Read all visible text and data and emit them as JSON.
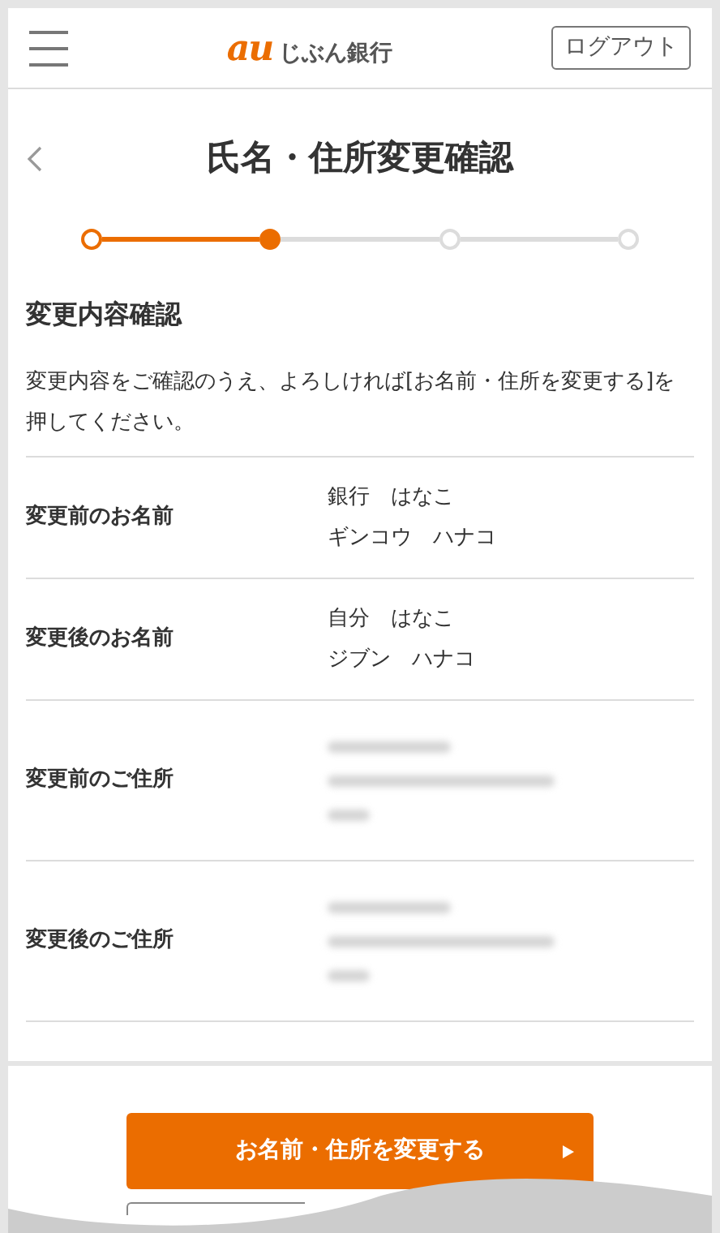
{
  "header": {
    "logo_mark": "au",
    "logo_text": "じぶん銀行",
    "logout": "ログアウト"
  },
  "title": "氏名・住所変更確認",
  "steps": [
    {
      "done": true,
      "selected": false
    },
    {
      "done": false,
      "selected": true
    },
    {
      "done": false,
      "selected": false
    },
    {
      "done": false,
      "selected": false
    }
  ],
  "section_title": "変更内容確認",
  "description": "変更内容をご確認のうえ、よろしければ[お名前・住所を変更する]を押してください。",
  "rows": [
    {
      "kind": "text",
      "label": "変更前のお名前",
      "lines": [
        "銀行　はなこ",
        "ギンコウ　ハナコ"
      ]
    },
    {
      "kind": "text",
      "label": "変更後のお名前",
      "lines": [
        "自分　はなこ",
        "ジブン　ハナコ"
      ]
    },
    {
      "kind": "redacted",
      "label": "変更前のご住所"
    },
    {
      "kind": "redacted",
      "label": "変更後のご住所"
    }
  ],
  "submit_button": "お名前・住所を変更する"
}
